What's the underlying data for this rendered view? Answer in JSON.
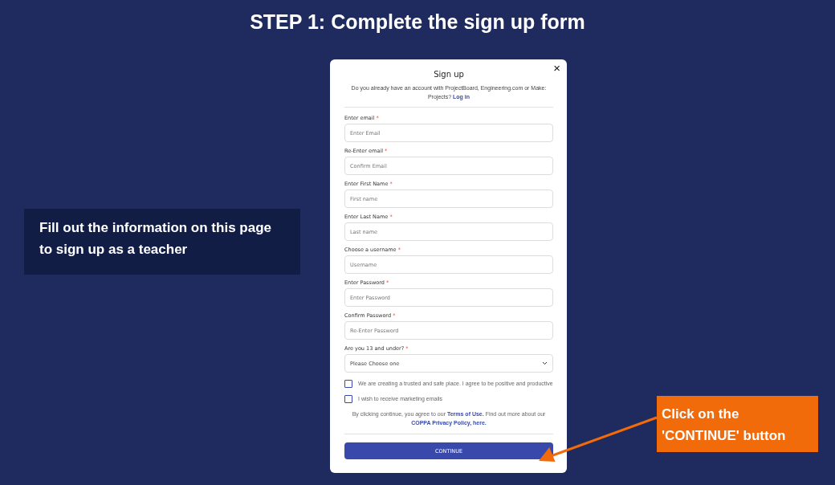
{
  "heading": "STEP 1: Complete the sign up form",
  "callout": "Fill out the information on this page to sign up as a teacher",
  "modal": {
    "title": "Sign up",
    "close": "×",
    "intro": "Do you already have an account with ProjectBoard, Engineering.com or Make: Projects?",
    "login_link": "Log in",
    "fields": [
      {
        "label": "Enter email",
        "required_mark": "*",
        "placeholder": "Enter Email"
      },
      {
        "label": "Re-Enter email",
        "required_mark": "*",
        "placeholder": "Confirm Email"
      },
      {
        "label": "Enter First Name",
        "required_mark": "*",
        "placeholder": "First name"
      },
      {
        "label": "Enter Last Name",
        "required_mark": "*",
        "placeholder": "Last name"
      },
      {
        "label": "Choose a username",
        "required_mark": "*",
        "placeholder": "Username"
      },
      {
        "label": "Enter Password",
        "required_mark": "*",
        "placeholder": "Enter Password"
      },
      {
        "label": "Confirm Password",
        "required_mark": "*",
        "placeholder": "Re-Enter Password"
      }
    ],
    "select": {
      "label": "Are you 13 and under?",
      "required_mark": "*",
      "value": "Please Choose one"
    },
    "checkboxes": [
      {
        "label": "We are creating a trusted and safe place. I agree to be positive and productive",
        "checked": false
      },
      {
        "label": "I wish to receive marketing emails",
        "checked": false
      }
    ],
    "notice": {
      "before": "By clicking continue, you agree to our",
      "terms_link": "Terms of Use.",
      "middle": "Find out more about our",
      "privacy_link": "COPPA Privacy Policy, here."
    },
    "button": "CONTINUE"
  },
  "annotation": "Click on the 'CONTINUE' button"
}
